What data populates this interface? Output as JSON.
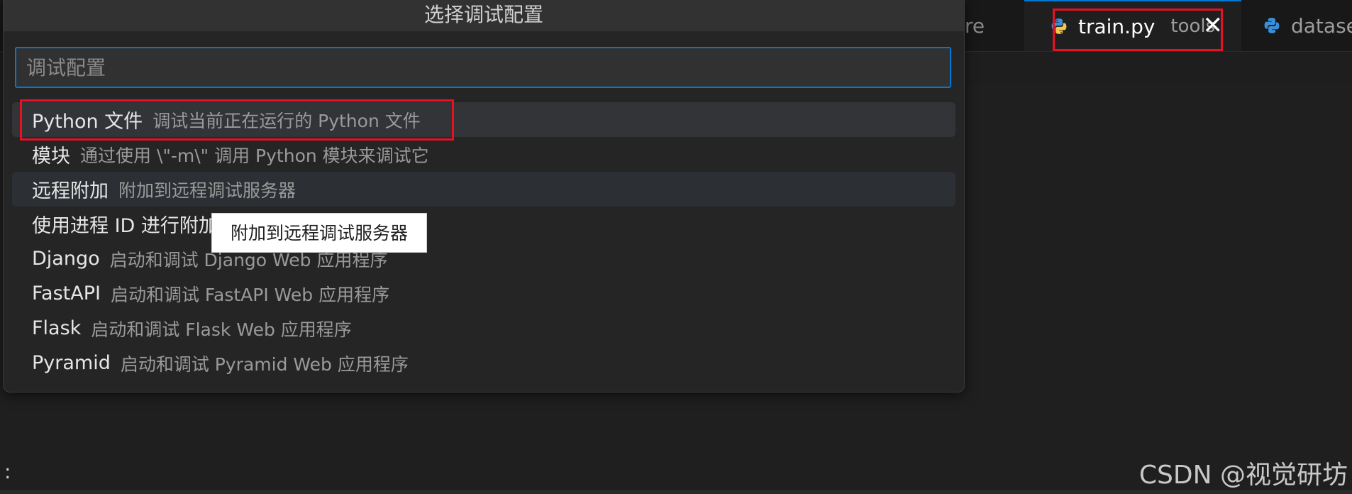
{
  "tabs": {
    "left_partial": "re",
    "active": {
      "name": "train.py",
      "description": "tools",
      "close_glyph": "✕"
    },
    "right_partial": "datase"
  },
  "quickpick": {
    "title": "选择调试配置",
    "input_placeholder": "调试配置",
    "items": [
      {
        "label": "Python 文件",
        "detail": "调试当前正在运行的 Python 文件"
      },
      {
        "label": "模块",
        "detail": "通过使用 \\\"-m\\\" 调用 Python 模块来调试它"
      },
      {
        "label": "远程附加",
        "detail": "附加到远程调试服务器"
      },
      {
        "label": "使用进程 ID 进行附加",
        "detail": ""
      },
      {
        "label": "Django",
        "detail": "启动和调试 Django Web 应用程序"
      },
      {
        "label": "FastAPI",
        "detail": "启动和调试 FastAPI Web 应用程序"
      },
      {
        "label": "Flask",
        "detail": "启动和调试 Flask Web 应用程序"
      },
      {
        "label": "Pyramid",
        "detail": "启动和调试 Pyramid Web 应用程序"
      }
    ]
  },
  "tooltip": "附加到远程调试服务器",
  "status_fragment": ":",
  "watermark": "CSDN @视觉研坊",
  "icons": {
    "python_file": "python-icon",
    "close": "close-icon"
  },
  "colors": {
    "accent": "#0078d4",
    "highlight": "#e81123",
    "python_blue": "#3b8fd9",
    "python_yellow": "#f2c94c"
  }
}
